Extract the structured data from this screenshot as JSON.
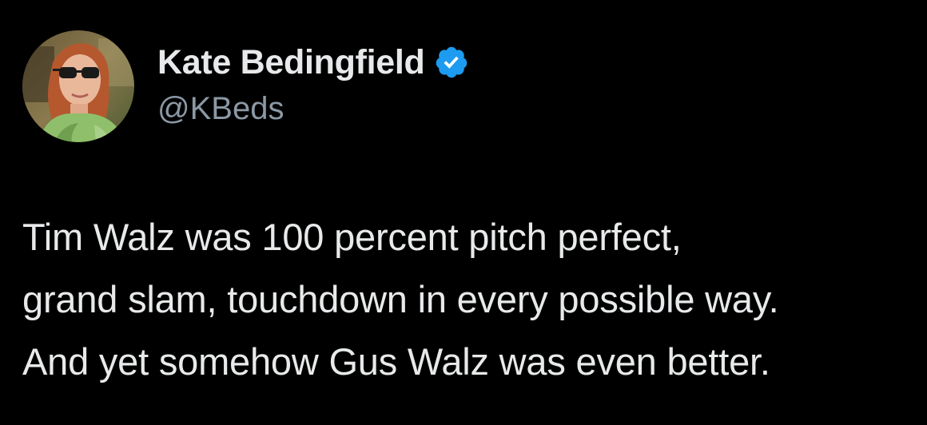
{
  "author": {
    "display_name": "Kate Bedingfield",
    "handle": "@KBeds",
    "verified": true,
    "verified_color": "#1d9bf0",
    "avatar_icon": "profile-photo"
  },
  "tweet": {
    "lines": [
      "Tim Walz was 100 percent pitch perfect,",
      "grand slam, touchdown in every possible way.",
      "And yet somehow Gus Walz was even better."
    ]
  },
  "theme": {
    "background": "#000000",
    "text_color": "#e7e9ea",
    "secondary_text_color": "#8b98a5"
  }
}
